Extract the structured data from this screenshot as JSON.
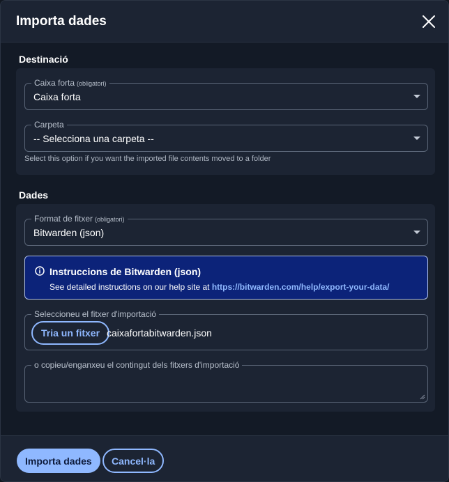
{
  "dialog": {
    "title": "Importa dades"
  },
  "destination": {
    "section_title": "Destinació",
    "vault": {
      "label": "Caixa forta",
      "required": "(obligatori)",
      "value": "Caixa forta"
    },
    "folder": {
      "label": "Carpeta",
      "value": "-- Selecciona una carpeta --",
      "hint": "Select this option if you want the imported file contents moved to a folder"
    }
  },
  "data": {
    "section_title": "Dades",
    "format": {
      "label": "Format de fitxer",
      "required": "(obligatori)",
      "value": "Bitwarden (json)"
    },
    "info": {
      "title": "Instruccions de Bitwarden (json)",
      "text": "See detailed instructions on our help site at ",
      "link": "https://bitwarden.com/help/export-your-data/"
    },
    "file": {
      "label": "Seleccioneu el fitxer d'importació",
      "button": "Tria un fitxer",
      "filename": "caixafortabitwarden.json"
    },
    "paste": {
      "label": "o copieu/enganxeu el contingut dels fitxers d'importació",
      "value": ""
    }
  },
  "footer": {
    "submit": "Importa dades",
    "cancel": "Cancel·la"
  },
  "colors": {
    "accent": "#8fb8ff",
    "info_bg": "#0c2379",
    "card_bg": "#1c2433",
    "page_bg": "#131a26"
  }
}
